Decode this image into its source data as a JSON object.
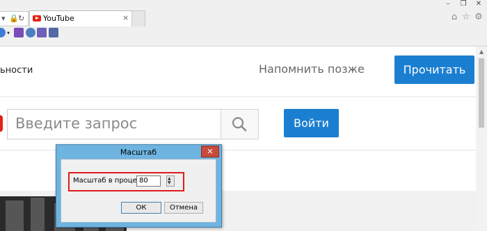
{
  "browser": {
    "tab_title": "YouTube",
    "tab_close": "×",
    "window_controls": {
      "minimize": "–",
      "restore": "❐",
      "close": "✕"
    },
    "tools_icons": [
      "home-icon",
      "star-icon",
      "gear-icon"
    ]
  },
  "page": {
    "banner_text": "ьности",
    "remind_later": "Напомнить позже",
    "read_button": "Прочитать",
    "search_placeholder": "Введите запрос",
    "login_button": "Войти"
  },
  "dialog": {
    "title": "Масштаб",
    "close": "✕",
    "scale_label": "Масштаб в процентах:",
    "scale_value": "80",
    "ok": "ОК",
    "cancel": "Отмена"
  },
  "colors": {
    "accent": "#1b7fd1",
    "highlight": "#e01a1a",
    "dialog_frame": "#6fb4e0"
  }
}
